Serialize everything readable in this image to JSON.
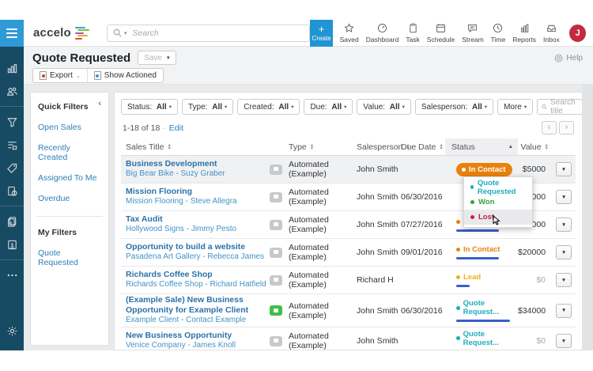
{
  "topbar": {
    "logo_text": "accelo",
    "search_placeholder": "Search",
    "create_label": "Create",
    "nav_items": [
      {
        "label": "Saved",
        "icon": "star-icon"
      },
      {
        "label": "Dashboard",
        "icon": "gauge-icon"
      },
      {
        "label": "Task",
        "icon": "clipboard-icon"
      },
      {
        "label": "Schedule",
        "icon": "calendar-icon"
      },
      {
        "label": "Stream",
        "icon": "chat-icon"
      },
      {
        "label": "Time",
        "icon": "clock-icon"
      },
      {
        "label": "Reports",
        "icon": "bar-chart-icon"
      },
      {
        "label": "Inbox",
        "icon": "inbox-icon"
      }
    ],
    "avatar_initial": "J"
  },
  "page_header": {
    "title": "Quote Requested",
    "save_label": "Save",
    "help_label": "Help",
    "export_label": "Export",
    "show_actioned_label": "Show Actioned"
  },
  "sidebar": {
    "items": [
      {
        "icon": "activity-chart-icon"
      },
      {
        "icon": "contacts-icon"
      },
      {
        "icon": "sales-funnel-icon",
        "divider_before": true
      },
      {
        "icon": "projects-icon"
      },
      {
        "icon": "tickets-tag-icon"
      },
      {
        "icon": "retainers-icon"
      },
      {
        "icon": "invoices-icon",
        "divider_before": true
      },
      {
        "icon": "payments-icon"
      },
      {
        "icon": "more-icon",
        "divider_before": true
      },
      {
        "icon": "settings-gear-icon",
        "pinned_bottom": true
      }
    ]
  },
  "quick_filters": {
    "title": "Quick Filters",
    "items": [
      "Open Sales",
      "Recently Created",
      "Assigned To Me",
      "Overdue"
    ],
    "my_filters_title": "My Filters",
    "my_filters_items": [
      "Quote Requested"
    ]
  },
  "filters": {
    "buttons": [
      {
        "label": "Status:",
        "value": "All"
      },
      {
        "label": "Type:",
        "value": "All"
      },
      {
        "label": "Created:",
        "value": "All"
      },
      {
        "label": "Due:",
        "value": "All"
      },
      {
        "label": "Value:",
        "value": "All"
      },
      {
        "label": "Salesperson:",
        "value": "All"
      },
      {
        "label": "More",
        "value": ""
      }
    ],
    "search_placeholder": "Search title"
  },
  "results": {
    "count_text": "1-18 of 18",
    "separator": "·",
    "edit_label": "Edit",
    "prev_label": "‹",
    "next_label": "›"
  },
  "table": {
    "columns": [
      "Sales Title",
      "Type",
      "Salesperson",
      "Due Date",
      "Status",
      "Value"
    ],
    "rows": [
      {
        "title": "Business Development",
        "subtitle": "Big Bear Bike - Suzy Graber",
        "type": "Automated (Example)",
        "salesperson": "John Smith",
        "due_date": "",
        "status": {
          "style": "pill",
          "label": "In Contact",
          "color": "#E8820D"
        },
        "value": "$5000",
        "value_muted": false,
        "selected": true
      },
      {
        "title": "Mission Flooring",
        "subtitle": "Mission Flooring - Steve Allegra",
        "type": "Automated (Example)",
        "salesperson": "John Smith",
        "due_date": "06/30/2016",
        "status": null,
        "value": "$40000",
        "value_muted": false
      },
      {
        "title": "Tax Audit",
        "subtitle": "Hollywood Signs - Jimmy Pesto",
        "type": "Automated (Example)",
        "salesperson": "John Smith",
        "due_date": "07/27/2016",
        "status": {
          "style": "text",
          "label": "In Contact",
          "color": "#E8820D",
          "bar": 54
        },
        "value": "$10000",
        "value_muted": false
      },
      {
        "title": "Opportunity to build a website",
        "subtitle": "Pasadena Art Gallery - Rebecca James",
        "type": "Automated (Example)",
        "salesperson": "John Smith",
        "due_date": "09/01/2016",
        "status": {
          "style": "text",
          "label": "In Contact",
          "color": "#E8820D",
          "bar": 54
        },
        "value": "$20000",
        "value_muted": false
      },
      {
        "title": "Richards Coffee Shop",
        "subtitle": "Richards Coffee Shop - Richard Hatfield",
        "type": "Automated (Example)",
        "salesperson": "Richard H",
        "due_date": "",
        "status": {
          "style": "text",
          "label": "Lead",
          "color": "#EFAF1C",
          "bar": 17
        },
        "value": "$0",
        "value_muted": true
      },
      {
        "title": "(Example Sale) New Business Opportunity for Example Client",
        "subtitle": "Example Client - Contact Example",
        "type": "Automated (Example)",
        "salesperson": "John Smith",
        "due_date": "06/30/2016",
        "status": {
          "style": "text",
          "label": "Quote Request...",
          "color": "#1BAEBE",
          "bar": 68
        },
        "value": "$34000",
        "value_muted": false,
        "icon_color": "#3FBF4A",
        "tall": true
      },
      {
        "title": "New Business Opportunity",
        "subtitle": "Venice Company - James Knoll",
        "type": "Automated (Example)",
        "salesperson": "John Smith",
        "due_date": "",
        "status": {
          "style": "text",
          "label": "Quote Request...",
          "color": "#1BAEBE",
          "bar": 68
        },
        "value": "$0",
        "value_muted": true
      }
    ]
  },
  "status_dropdown": {
    "items": [
      {
        "label": "Quote Requested",
        "color": "#1BAEBE"
      },
      {
        "label": "Won",
        "color": "#2BA43C"
      },
      {
        "label": "Lost",
        "color": "#C51F3F",
        "hovered": true
      }
    ]
  },
  "colors": {
    "sidebar_bg": "#174A63",
    "hamburger_bg": "#2E9BD6",
    "create_bg": "#2095D3",
    "avatar_bg": "#C22B3E",
    "link_blue": "#2E7FB8",
    "progress_bar": "#3A5FC8",
    "status_orange": "#E8820D",
    "status_teal": "#1BAEBE",
    "status_green": "#2BA43C",
    "status_red": "#C51F3F",
    "status_amber": "#EFAF1C",
    "logo_bars": [
      "#2FA8E0",
      "#7DC242",
      "#9B59B6",
      "#F5A623",
      "#E74C3C"
    ]
  }
}
